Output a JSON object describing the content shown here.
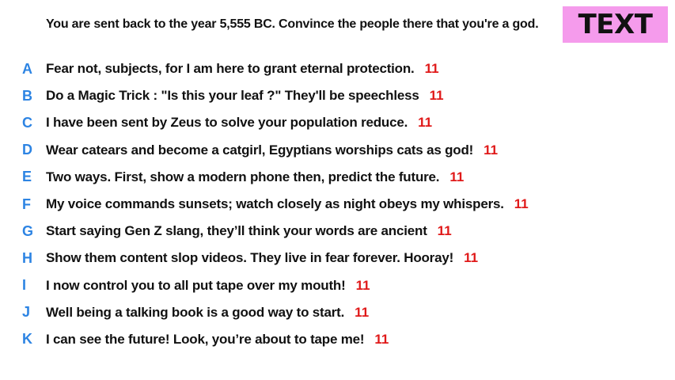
{
  "prompt": "You are sent back to the year 5,555 BC. Convince the people there that you're a god.",
  "badge_label": "TEXT",
  "colors": {
    "badge_background": "#f59bec",
    "letter": "#2d84e3",
    "votes": "#e01919",
    "text": "#111111"
  },
  "answers": [
    {
      "letter": "A",
      "text": "Fear not, subjects, for I am here to grant eternal protection.",
      "votes": "11"
    },
    {
      "letter": "B",
      "text": "Do a Magic Trick : \"Is this your leaf ?\" They'll be speechless",
      "votes": "11"
    },
    {
      "letter": "C",
      "text": "I have been sent by Zeus to solve your population reduce.",
      "votes": "11"
    },
    {
      "letter": "D",
      "text": "Wear catears and become a catgirl, Egyptians worships cats as god!",
      "votes": "11"
    },
    {
      "letter": "E",
      "text": "Two ways. First, show a modern phone then, predict the future.",
      "votes": "11"
    },
    {
      "letter": "F",
      "text": "My voice commands sunsets; watch closely as night obeys my whispers.",
      "votes": "11"
    },
    {
      "letter": "G",
      "text": "Start saying Gen Z slang, they’ll think your words are ancient",
      "votes": "11"
    },
    {
      "letter": "H",
      "text": "Show them content slop videos. They live in fear forever. Hooray!",
      "votes": "11"
    },
    {
      "letter": "I",
      "text": "I now control you to all put tape over my mouth!",
      "votes": "11"
    },
    {
      "letter": "J",
      "text": "Well being a talking book is a good way to start.",
      "votes": "11"
    },
    {
      "letter": "K",
      "text": "I can see the future! Look, you’re about to tape me!",
      "votes": "11"
    }
  ]
}
